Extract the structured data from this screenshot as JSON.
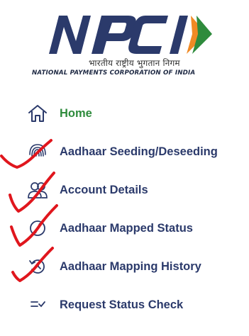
{
  "brand": {
    "logo_text": "NPCI",
    "tagline_hindi": "भारतीय राष्ट्रीय भुगतान निगम",
    "tagline_english": "NATIONAL PAYMENTS CORPORATION OF INDIA",
    "colors": {
      "navy": "#2b3a6b",
      "green": "#2e8b3c",
      "orange": "#f08a24",
      "check_red": "#e0161d"
    }
  },
  "nav": {
    "items": [
      {
        "label": "Home",
        "icon": "home-icon",
        "active": true
      },
      {
        "label": "Aadhaar Seeding/Deseeding",
        "icon": "fingerprint-icon",
        "active": false
      },
      {
        "label": "Account Details",
        "icon": "users-icon",
        "active": false
      },
      {
        "label": "Aadhaar Mapped Status",
        "icon": "circle-slash-icon",
        "active": false
      },
      {
        "label": "Aadhaar Mapping History",
        "icon": "history-icon",
        "active": false
      },
      {
        "label": "Request Status Check",
        "icon": "list-check-icon",
        "active": false
      }
    ]
  }
}
